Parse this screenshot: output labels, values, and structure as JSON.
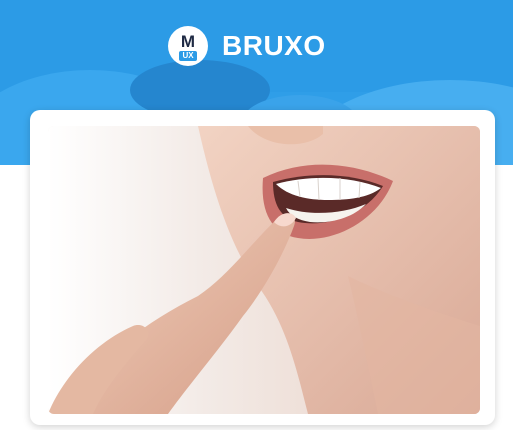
{
  "app": {
    "logo": {
      "letter": "M",
      "sub": "UX"
    },
    "title": "BRUXO"
  },
  "colors": {
    "header_blue": "#2c9be6",
    "white": "#ffffff"
  },
  "hero_image": {
    "subject": "smiling-woman-touching-teeth"
  }
}
